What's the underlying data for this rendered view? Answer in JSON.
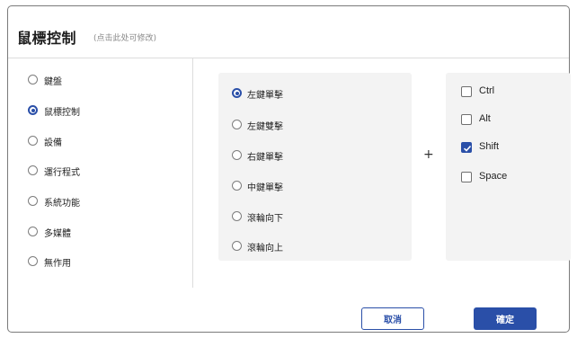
{
  "dialog": {
    "title": "鼠標控制",
    "hint": "(点击此处可修改)"
  },
  "categories": [
    {
      "label": "鍵盤",
      "selected": false
    },
    {
      "label": "鼠標控制",
      "selected": true
    },
    {
      "label": "設備",
      "selected": false
    },
    {
      "label": "運行程式",
      "selected": false
    },
    {
      "label": "系統功能",
      "selected": false
    },
    {
      "label": "多媒體",
      "selected": false
    },
    {
      "label": "無作用",
      "selected": false
    }
  ],
  "mouse_actions": [
    {
      "label": "左鍵單擊",
      "selected": true
    },
    {
      "label": "左鍵雙擊",
      "selected": false
    },
    {
      "label": "右鍵單擊",
      "selected": false
    },
    {
      "label": "中鍵單擊",
      "selected": false
    },
    {
      "label": "滾輪向下",
      "selected": false
    },
    {
      "label": "滾輪向上",
      "selected": false
    }
  ],
  "combinator": "+",
  "modifiers": [
    {
      "label": "Ctrl",
      "checked": false
    },
    {
      "label": "Alt",
      "checked": false
    },
    {
      "label": "Shift",
      "checked": true
    },
    {
      "label": "Space",
      "checked": false
    }
  ],
  "buttons": {
    "cancel": "取消",
    "ok": "確定"
  },
  "colors": {
    "accent": "#2a4fa8",
    "panel_bg": "#f3f3f3",
    "divider": "#dcdcdc"
  }
}
